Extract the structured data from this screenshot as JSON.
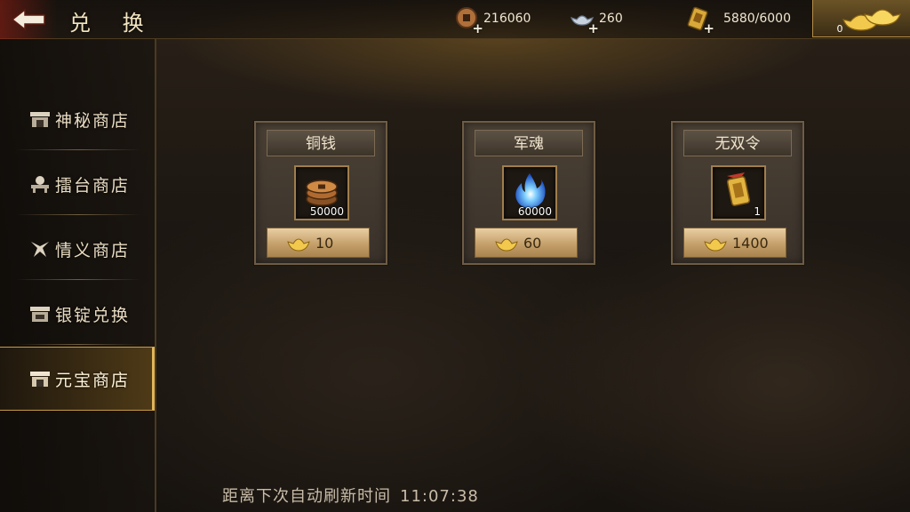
{
  "header": {
    "title": "兑 换",
    "back_icon": "back-arrow-icon",
    "currencies": [
      {
        "icon": "copper-coin-icon",
        "value": "216060"
      },
      {
        "icon": "silver-ingot-icon",
        "value": "260"
      },
      {
        "icon": "token-icon",
        "value": "5880/6000"
      }
    ],
    "gold_ingot": {
      "icon": "gold-ingot-icon",
      "value": "0"
    }
  },
  "sidebar": {
    "items": [
      {
        "label": "神秘商店",
        "icon": "shop-icon",
        "active": false
      },
      {
        "label": "擂台商店",
        "icon": "arena-icon",
        "active": false
      },
      {
        "label": "情义商店",
        "icon": "heroes-icon",
        "active": false
      },
      {
        "label": "银锭兑换",
        "icon": "exchange-icon",
        "active": false
      },
      {
        "label": "元宝商店",
        "icon": "shop-icon",
        "active": true
      }
    ]
  },
  "shop": {
    "items": [
      {
        "title": "铜钱",
        "icon": "copper-coins-icon",
        "quantity": "50000",
        "price": "10",
        "price_icon": "gold-ingot-icon"
      },
      {
        "title": "军魂",
        "icon": "blue-flame-icon",
        "quantity": "60000",
        "price": "60",
        "price_icon": "gold-ingot-icon"
      },
      {
        "title": "无双令",
        "icon": "gold-token-icon",
        "quantity": "1",
        "price": "1400",
        "price_icon": "gold-ingot-icon"
      }
    ]
  },
  "footer": {
    "refresh_label": "距离下次自动刷新时间",
    "refresh_time": "11:07:38"
  },
  "colors": {
    "accent_gold": "#e0b458",
    "price_button": "#c5a06a",
    "card_border": "#6e5c44"
  }
}
